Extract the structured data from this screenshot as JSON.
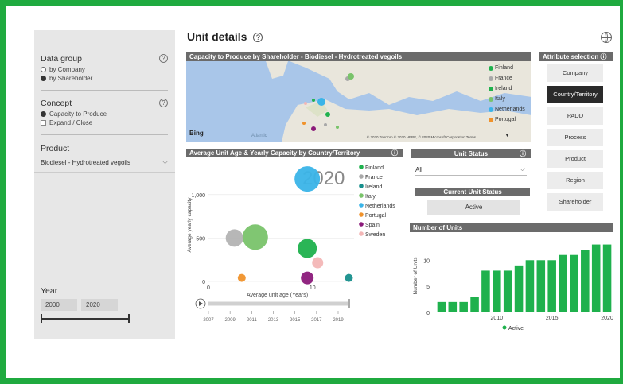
{
  "page": {
    "title": "Unit details"
  },
  "left": {
    "data_group": {
      "label": "Data group",
      "options": [
        "by Company",
        "by Shareholder"
      ],
      "selected": 1
    },
    "concept": {
      "label": "Concept",
      "options": [
        "Capacity to Produce",
        "Expand / Close"
      ]
    },
    "product": {
      "label": "Product",
      "value": "Biodiesel - Hydrotreated vegoils"
    },
    "year": {
      "label": "Year",
      "from": "2000",
      "to": "2020"
    }
  },
  "map_panel": {
    "header": "Capacity to Produce by Shareholder - Biodiesel - Hydrotreated vegoils",
    "legend": [
      {
        "name": "Finland",
        "color": "#1fb14d"
      },
      {
        "name": "France",
        "color": "#a8a8a8"
      },
      {
        "name": "Ireland",
        "color": "#1fb14d"
      },
      {
        "name": "Italy",
        "color": "#79c36a"
      },
      {
        "name": "Netherlands",
        "color": "#3ab4e8"
      },
      {
        "name": "Portugal",
        "color": "#f0922b"
      }
    ],
    "bing": "Bing",
    "atlantic": "Atlantic",
    "copyright": "© 2020 TomTom © 2020 HERE, © 2020 Microsoft Corporation Terms"
  },
  "attributes": {
    "header": "Attribute selection",
    "buttons": [
      "Company",
      "Country/Territory",
      "PADD",
      "Process",
      "Product",
      "Region",
      "Shareholder"
    ],
    "active": "Country/Territory"
  },
  "bubble_panel": {
    "header": "Average Unit Age & Yearly Capacity by Country/Territory",
    "year_label": "2020",
    "timeline_ticks": [
      "2007",
      "2009",
      "2011",
      "2013",
      "2015",
      "2017",
      "2019"
    ]
  },
  "unit_status": {
    "header": "Unit Status",
    "value": "All",
    "current_header": "Current Unit Status",
    "current_value": "Active"
  },
  "units_panel": {
    "header": "Number of Units"
  },
  "chart_data": [
    {
      "type": "scatter",
      "title": "",
      "xlabel": "Average unit age (Years)",
      "ylabel": "Average yearly capacity",
      "xlim": [
        0,
        14
      ],
      "ylim": [
        0,
        1300
      ],
      "yticks": [
        "0",
        "500",
        "1,000"
      ],
      "xticks": [
        "0",
        "10"
      ],
      "points": [
        {
          "name": "France",
          "x": 2.5,
          "y": 500,
          "size": 11,
          "color": "#b3b3b3"
        },
        {
          "name": "Italy",
          "x": 4.5,
          "y": 510,
          "size": 16,
          "color": "#79c36a"
        },
        {
          "name": "Netherlands",
          "x": 9.5,
          "y": 1180,
          "size": 16,
          "color": "#3ab4e8"
        },
        {
          "name": "Finland",
          "x": 9.5,
          "y": 380,
          "size": 12,
          "color": "#1fb14d"
        },
        {
          "name": "Sweden",
          "x": 10.5,
          "y": 215,
          "size": 7,
          "color": "#f3b6b6"
        },
        {
          "name": "Spain",
          "x": 9.5,
          "y": 40,
          "size": 8,
          "color": "#8b1a7a"
        },
        {
          "name": "Portugal",
          "x": 3.2,
          "y": 40,
          "size": 5,
          "color": "#f0922b"
        },
        {
          "name": "Ireland",
          "x": 13.5,
          "y": 40,
          "size": 5,
          "color": "#178f8c"
        }
      ],
      "legend": [
        {
          "name": "Finland",
          "color": "#1fb14d"
        },
        {
          "name": "France",
          "color": "#a8a8a8"
        },
        {
          "name": "Ireland",
          "color": "#178f8c"
        },
        {
          "name": "Italy",
          "color": "#79c36a"
        },
        {
          "name": "Netherlands",
          "color": "#3ab4e8"
        },
        {
          "name": "Portugal",
          "color": "#f0922b"
        },
        {
          "name": "Spain",
          "color": "#8b1a7a"
        },
        {
          "name": "Sweden",
          "color": "#f3b6b6"
        }
      ]
    },
    {
      "type": "bar",
      "title": "Number of Units",
      "xlabel": "",
      "ylabel": "Number of Units",
      "x": [
        2005,
        2006,
        2007,
        2008,
        2009,
        2010,
        2011,
        2012,
        2013,
        2014,
        2015,
        2016,
        2017,
        2018,
        2019,
        2020
      ],
      "values": [
        2,
        2,
        2,
        3,
        8,
        8,
        8,
        9,
        10,
        10,
        10,
        11,
        11,
        12,
        13,
        13
      ],
      "xticks": [
        "2010",
        "2015",
        "2020"
      ],
      "yticks": [
        "0",
        "5",
        "10"
      ],
      "ylim": [
        0,
        14
      ],
      "series": [
        {
          "name": "Active",
          "color": "#1fb14d"
        }
      ]
    }
  ]
}
